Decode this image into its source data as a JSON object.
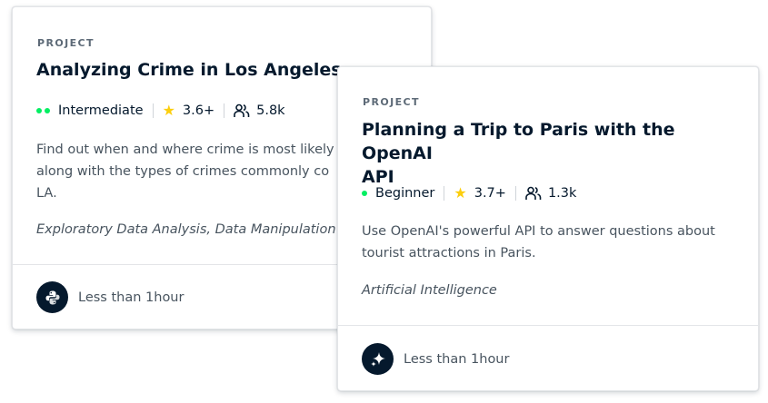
{
  "cards": [
    {
      "kind": "PROJECT",
      "title": "Analyzing Crime in Los Angeles",
      "level": "Intermediate",
      "rating": "3.6+",
      "learners": "5.8k",
      "description_lines": [
        "Find out when and where crime is most likely",
        "along with the types of crimes commonly co",
        "LA."
      ],
      "tags": "Exploratory Data Analysis, Data Manipulation",
      "duration": "Less than 1hour",
      "tech_icon": "python-icon",
      "level_dots": 2
    },
    {
      "kind": "PROJECT",
      "title_lines": [
        "Planning a Trip to Paris with the OpenAI",
        "API"
      ],
      "level": "Beginner",
      "rating": "3.7+",
      "learners": "1.3k",
      "description_lines": [
        "Use OpenAI's powerful API to answer questions about",
        "tourist attractions in Paris."
      ],
      "tags": "Artificial Intelligence",
      "duration": "Less than 1hour",
      "tech_icon": "sparkle-ai-icon",
      "level_dots": 1
    }
  ],
  "colors": {
    "accent_green": "#03ef62",
    "star_yellow": "#fcce0d",
    "navy": "#05192d"
  }
}
